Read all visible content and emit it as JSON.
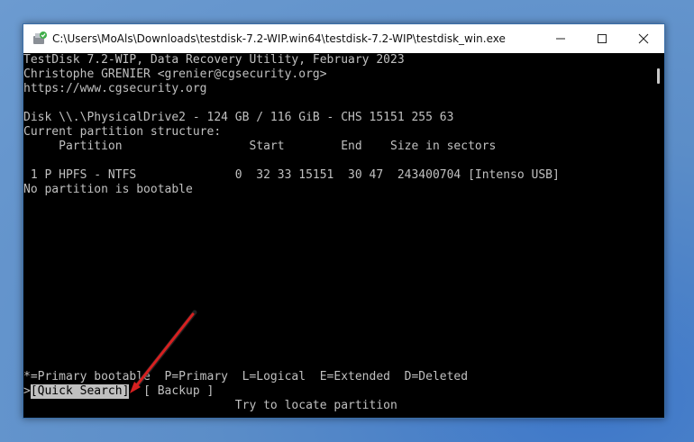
{
  "window": {
    "title": "C:\\Users\\MoAls\\Downloads\\testdisk-7.2-WIP.win64\\testdisk-7.2-WIP\\testdisk_win.exe"
  },
  "console": {
    "header1": "TestDisk 7.2-WIP, Data Recovery Utility, February 2023",
    "header2": "Christophe GRENIER <grenier@cgsecurity.org>",
    "header3": "https://www.cgsecurity.org",
    "disk": "Disk \\\\.\\PhysicalDrive2 - 124 GB / 116 GiB - CHS 15151 255 63",
    "structure": "Current partition structure:",
    "columns": "     Partition                  Start        End    Size in sectors",
    "row1": " 1 P HPFS - NTFS              0  32 33 15151  30 47  243400704 [Intenso USB]",
    "bootable": "No partition is bootable",
    "legend": "*=Primary bootable  P=Primary  L=Logical  E=Extended  D=Deleted",
    "menu_prefix": ">",
    "quick_search": "[Quick Search]",
    "backup": "[ Backup ]",
    "hint": "                              Try to locate partition"
  },
  "icons": {
    "app": "testdisk-app-icon",
    "minimize": "minimize-icon",
    "maximize": "maximize-icon",
    "close": "close-icon",
    "annotation": "red-arrow-icon"
  },
  "colors": {
    "console_bg": "#000000",
    "console_text": "#c0c0c0",
    "selection_bg": "#c0c0c0",
    "arrow": "#d62020"
  }
}
